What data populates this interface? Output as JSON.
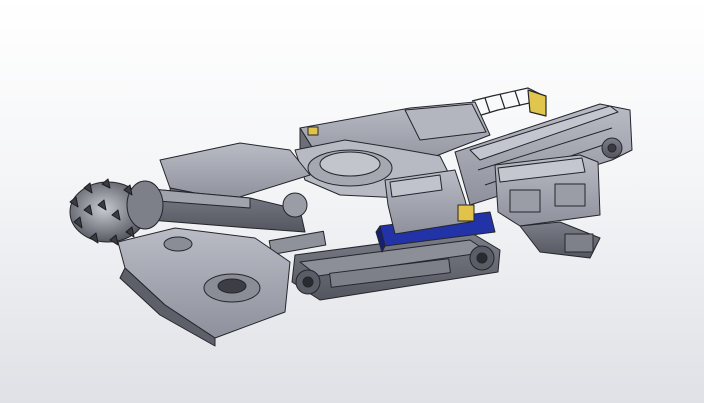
{
  "scene": {
    "description_free": true,
    "background": {
      "top": "#ffffff",
      "bottom": "#dfe1e6"
    },
    "colors": {
      "body_light": "#a9abb6",
      "body_mid": "#8d8f9a",
      "body_dark": "#5c5e68",
      "edge": "#25262c",
      "track": "#6f717b",
      "blue_frame": "#2233a8",
      "yellow_box": "#e2c34a"
    }
  }
}
